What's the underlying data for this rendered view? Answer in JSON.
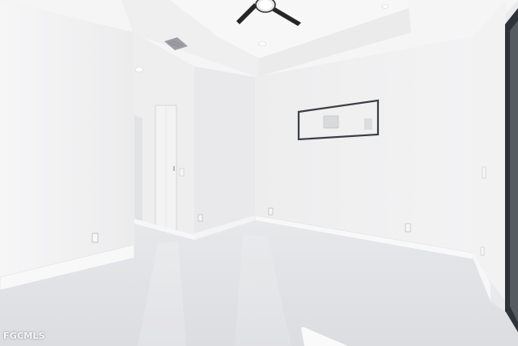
{
  "watermark": {
    "text": "FGCMLS"
  },
  "palette": {
    "wall_light": "#f4f4f5",
    "wall_shade": "#e6e7e9",
    "ceiling": "#f6f6f7",
    "floor": "#e2e3e6",
    "door": "#f1f1f2",
    "window_frame": "#2b2f36",
    "fan_blade": "#2a2a2a"
  },
  "icons": [
    "ceiling-fan-icon",
    "recessed-light-icon",
    "air-vent-icon",
    "electrical-outlet-icon",
    "door-icon",
    "window-icon"
  ]
}
